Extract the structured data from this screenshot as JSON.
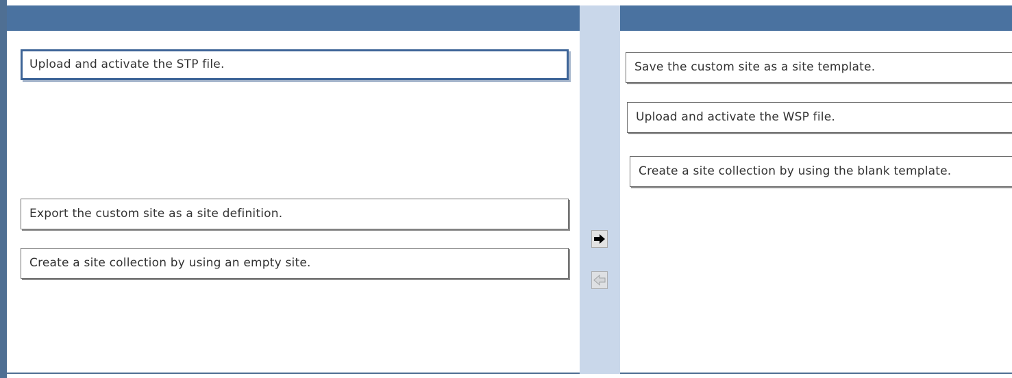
{
  "left_panel": {
    "items": [
      {
        "label": "Upload and activate the STP file.",
        "selected": true
      },
      {
        "label": "Export the custom site as a site definition.",
        "selected": false
      },
      {
        "label": "Create a site collection by using an empty site.",
        "selected": false
      }
    ]
  },
  "right_panel": {
    "items": [
      {
        "label": "Save the custom site as a site template."
      },
      {
        "label": "Upload and activate the WSP file."
      },
      {
        "label": "Create a site collection by using the blank template."
      }
    ]
  },
  "controls": {
    "move_right_icon": "arrow-right-icon",
    "move_left_icon": "arrow-left-icon",
    "move_left_enabled": false
  },
  "colors": {
    "header": "#4a72a0",
    "middle_strip": "#c9d7ea",
    "selected_border": "#3d6497"
  }
}
